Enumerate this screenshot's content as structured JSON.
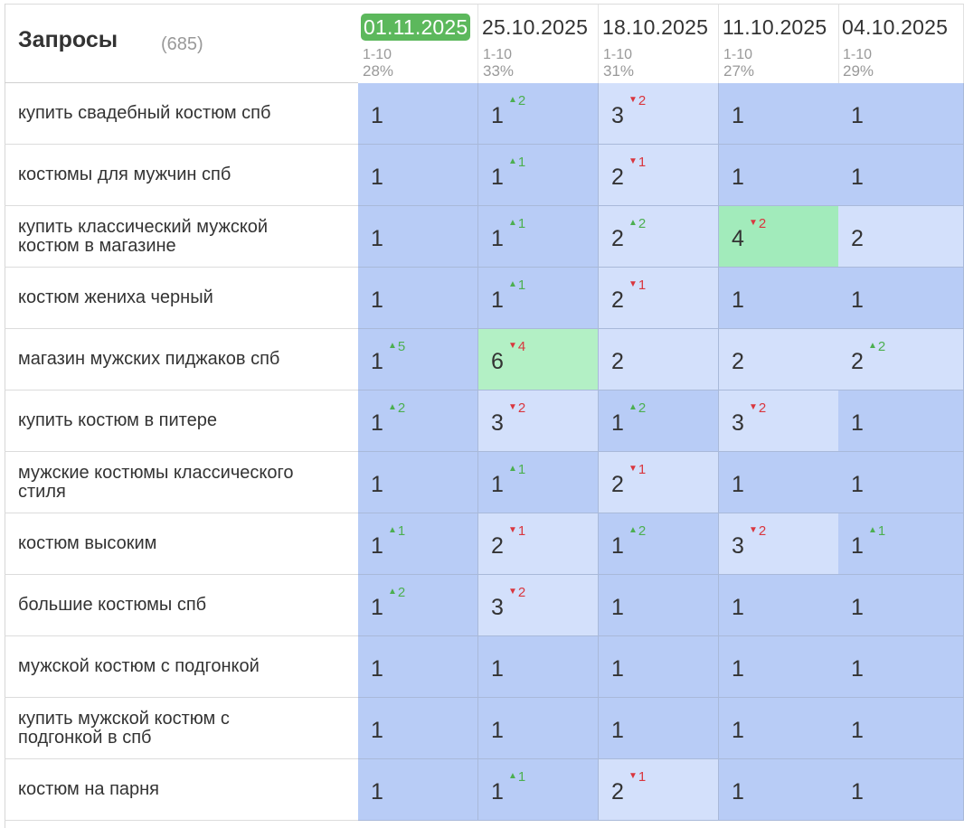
{
  "header": {
    "title": "Запросы",
    "count": "(685)"
  },
  "columns": [
    {
      "date": "01.11.2025",
      "range": "1-10",
      "percent": "28%",
      "active": true
    },
    {
      "date": "25.10.2025",
      "range": "1-10",
      "percent": "33%"
    },
    {
      "date": "18.10.2025",
      "range": "1-10",
      "percent": "31%"
    },
    {
      "date": "11.10.2025",
      "range": "1-10",
      "percent": "27%"
    },
    {
      "date": "04.10.2025",
      "range": "1-10",
      "percent": "29%"
    }
  ],
  "colors": {
    "blue_strong": "#b8ccf6",
    "blue_medium": "#c5d5f8",
    "blue_light": "#d3e0fb",
    "green": "#b3f0c5",
    "green_strong": "#a2ebbb",
    "delta_up": "#4caf50",
    "delta_down": "#d9363e",
    "active_date": "#5cb85c"
  },
  "rows": [
    {
      "query": "купить свадебный костюм спб",
      "cells": [
        {
          "pos": "1",
          "delta": "",
          "color": "blue_strong"
        },
        {
          "pos": "1",
          "delta": "2",
          "dir": "up",
          "color": "blue_strong"
        },
        {
          "pos": "3",
          "delta": "2",
          "dir": "down",
          "color": "blue_light"
        },
        {
          "pos": "1",
          "delta": "",
          "color": "blue_strong"
        },
        {
          "pos": "1",
          "delta": "",
          "color": "blue_strong"
        }
      ]
    },
    {
      "query": "костюмы для мужчин спб",
      "cells": [
        {
          "pos": "1",
          "delta": "",
          "color": "blue_strong"
        },
        {
          "pos": "1",
          "delta": "1",
          "dir": "up",
          "color": "blue_strong"
        },
        {
          "pos": "2",
          "delta": "1",
          "dir": "down",
          "color": "blue_light"
        },
        {
          "pos": "1",
          "delta": "",
          "color": "blue_strong"
        },
        {
          "pos": "1",
          "delta": "",
          "color": "blue_strong"
        }
      ]
    },
    {
      "query": "купить классический мужской костюм в магазине",
      "cells": [
        {
          "pos": "1",
          "delta": "",
          "color": "blue_strong"
        },
        {
          "pos": "1",
          "delta": "1",
          "dir": "up",
          "color": "blue_strong"
        },
        {
          "pos": "2",
          "delta": "2",
          "dir": "up",
          "color": "blue_light"
        },
        {
          "pos": "4",
          "delta": "2",
          "dir": "down",
          "color": "green_strong"
        },
        {
          "pos": "2",
          "delta": "",
          "color": "blue_light"
        }
      ]
    },
    {
      "query": "костюм жениха черный",
      "cells": [
        {
          "pos": "1",
          "delta": "",
          "color": "blue_strong"
        },
        {
          "pos": "1",
          "delta": "1",
          "dir": "up",
          "color": "blue_strong"
        },
        {
          "pos": "2",
          "delta": "1",
          "dir": "down",
          "color": "blue_light"
        },
        {
          "pos": "1",
          "delta": "",
          "color": "blue_strong"
        },
        {
          "pos": "1",
          "delta": "",
          "color": "blue_strong"
        }
      ]
    },
    {
      "query": "магазин мужских пиджаков спб",
      "cells": [
        {
          "pos": "1",
          "delta": "5",
          "dir": "up",
          "color": "blue_strong"
        },
        {
          "pos": "6",
          "delta": "4",
          "dir": "down",
          "color": "green"
        },
        {
          "pos": "2",
          "delta": "",
          "color": "blue_light"
        },
        {
          "pos": "2",
          "delta": "",
          "color": "blue_light"
        },
        {
          "pos": "2",
          "delta": "2",
          "dir": "up",
          "color": "blue_light"
        }
      ]
    },
    {
      "query": "купить костюм в питере",
      "cells": [
        {
          "pos": "1",
          "delta": "2",
          "dir": "up",
          "color": "blue_strong"
        },
        {
          "pos": "3",
          "delta": "2",
          "dir": "down",
          "color": "blue_light"
        },
        {
          "pos": "1",
          "delta": "2",
          "dir": "up",
          "color": "blue_strong"
        },
        {
          "pos": "3",
          "delta": "2",
          "dir": "down",
          "color": "blue_light"
        },
        {
          "pos": "1",
          "delta": "",
          "color": "blue_strong"
        }
      ]
    },
    {
      "query": "мужские костюмы классического стиля",
      "cells": [
        {
          "pos": "1",
          "delta": "",
          "color": "blue_strong"
        },
        {
          "pos": "1",
          "delta": "1",
          "dir": "up",
          "color": "blue_strong"
        },
        {
          "pos": "2",
          "delta": "1",
          "dir": "down",
          "color": "blue_light"
        },
        {
          "pos": "1",
          "delta": "",
          "color": "blue_strong"
        },
        {
          "pos": "1",
          "delta": "",
          "color": "blue_strong"
        }
      ]
    },
    {
      "query": "костюм высоким",
      "cells": [
        {
          "pos": "1",
          "delta": "1",
          "dir": "up",
          "color": "blue_strong"
        },
        {
          "pos": "2",
          "delta": "1",
          "dir": "down",
          "color": "blue_light"
        },
        {
          "pos": "1",
          "delta": "2",
          "dir": "up",
          "color": "blue_strong"
        },
        {
          "pos": "3",
          "delta": "2",
          "dir": "down",
          "color": "blue_light"
        },
        {
          "pos": "1",
          "delta": "1",
          "dir": "up",
          "color": "blue_strong"
        }
      ]
    },
    {
      "query": "большие костюмы спб",
      "cells": [
        {
          "pos": "1",
          "delta": "2",
          "dir": "up",
          "color": "blue_strong"
        },
        {
          "pos": "3",
          "delta": "2",
          "dir": "down",
          "color": "blue_light"
        },
        {
          "pos": "1",
          "delta": "",
          "color": "blue_strong"
        },
        {
          "pos": "1",
          "delta": "",
          "color": "blue_strong"
        },
        {
          "pos": "1",
          "delta": "",
          "color": "blue_strong"
        }
      ]
    },
    {
      "query": "мужской костюм с подгонкой",
      "cells": [
        {
          "pos": "1",
          "delta": "",
          "color": "blue_strong"
        },
        {
          "pos": "1",
          "delta": "",
          "color": "blue_strong"
        },
        {
          "pos": "1",
          "delta": "",
          "color": "blue_strong"
        },
        {
          "pos": "1",
          "delta": "",
          "color": "blue_strong"
        },
        {
          "pos": "1",
          "delta": "",
          "color": "blue_strong"
        }
      ]
    },
    {
      "query": "купить мужской костюм с подгонкой в спб",
      "cells": [
        {
          "pos": "1",
          "delta": "",
          "color": "blue_strong"
        },
        {
          "pos": "1",
          "delta": "",
          "color": "blue_strong"
        },
        {
          "pos": "1",
          "delta": "",
          "color": "blue_strong"
        },
        {
          "pos": "1",
          "delta": "",
          "color": "blue_strong"
        },
        {
          "pos": "1",
          "delta": "",
          "color": "blue_strong"
        }
      ]
    },
    {
      "query": "костюм на парня",
      "cells": [
        {
          "pos": "1",
          "delta": "",
          "color": "blue_strong"
        },
        {
          "pos": "1",
          "delta": "1",
          "dir": "up",
          "color": "blue_strong"
        },
        {
          "pos": "2",
          "delta": "1",
          "dir": "down",
          "color": "blue_light"
        },
        {
          "pos": "1",
          "delta": "",
          "color": "blue_strong"
        },
        {
          "pos": "1",
          "delta": "",
          "color": "blue_strong"
        }
      ]
    }
  ]
}
